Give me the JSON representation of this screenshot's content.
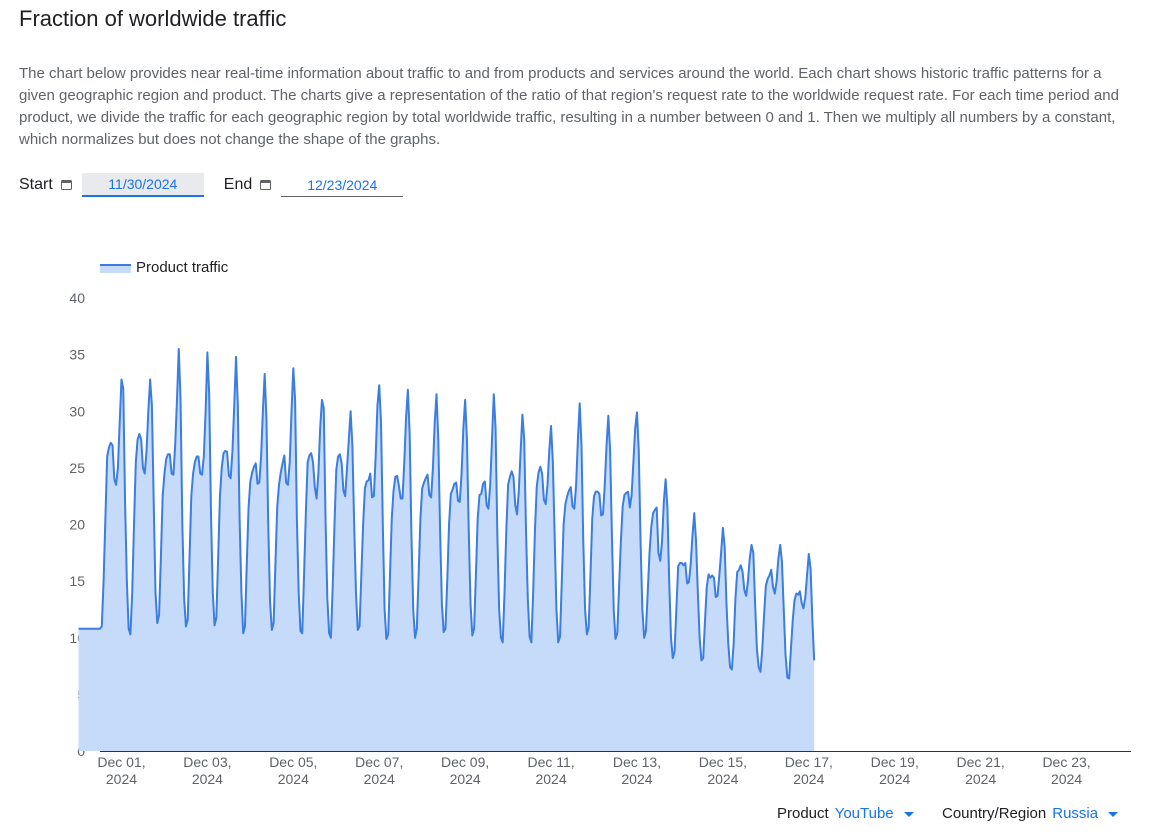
{
  "header": {
    "title": "Fraction of worldwide traffic",
    "description": "The chart below provides near real-time information about traffic to and from products and services around the world. Each chart shows historic traffic patterns for a given geographic region and product. The charts give a representation of the ratio of that region's request rate to the worldwide request rate. For each time period and product, we divide the traffic for each geographic region by total worldwide traffic, resulting in a number between 0 and 1. Then we multiply all numbers by a constant, which normalizes but does not change the shape of the graphs."
  },
  "filters": {
    "start_label": "Start",
    "start_value": "11/30/2024",
    "end_label": "End",
    "end_value": "12/23/2024"
  },
  "footer": {
    "product_label": "Product",
    "product_value": "YouTube",
    "region_label": "Country/Region",
    "region_value": "Russia"
  },
  "colors": {
    "line": "#3b7de0",
    "fill": "#c6dafa",
    "accent": "#1a73e8"
  },
  "chart_data": {
    "type": "area",
    "legend": "top-left",
    "grid": false,
    "series": [
      {
        "name": "Product traffic"
      }
    ],
    "ylim": [
      0,
      40
    ],
    "yticks": [
      0,
      5,
      10,
      15,
      20,
      25,
      30,
      35,
      40
    ],
    "xlim": [
      "2024-11-30T12:00",
      "2024-12-24T12:00"
    ],
    "xticks": [
      {
        "date": "2024-12-01T00:00",
        "line1": "Dec 01,",
        "line2": "2024"
      },
      {
        "date": "2024-12-03T00:00",
        "line1": "Dec 03,",
        "line2": "2024"
      },
      {
        "date": "2024-12-05T00:00",
        "line1": "Dec 05,",
        "line2": "2024"
      },
      {
        "date": "2024-12-07T00:00",
        "line1": "Dec 07,",
        "line2": "2024"
      },
      {
        "date": "2024-12-09T00:00",
        "line1": "Dec 09,",
        "line2": "2024"
      },
      {
        "date": "2024-12-11T00:00",
        "line1": "Dec 11,",
        "line2": "2024"
      },
      {
        "date": "2024-12-13T00:00",
        "line1": "Dec 13,",
        "line2": "2024"
      },
      {
        "date": "2024-12-15T00:00",
        "line1": "Dec 15,",
        "line2": "2024"
      },
      {
        "date": "2024-12-17T00:00",
        "line1": "Dec 17,",
        "line2": "2024"
      },
      {
        "date": "2024-12-19T00:00",
        "line1": "Dec 19,",
        "line2": "2024"
      },
      {
        "date": "2024-12-21T00:00",
        "line1": "Dec 21,",
        "line2": "2024"
      },
      {
        "date": "2024-12-23T00:00",
        "line1": "Dec 23,",
        "line2": "2024"
      }
    ],
    "days": [
      {
        "date": "2024-11-30",
        "values": [
          10.8,
          10.8,
          10.8,
          10.8,
          10.8,
          10.8,
          10.8,
          10.8,
          10.8,
          10.8,
          10.8,
          10.8,
          10.8,
          11,
          15,
          20.5,
          26,
          26.8,
          27.2,
          27,
          24,
          23.5,
          25,
          29
        ]
      },
      {
        "date": "2024-12-01",
        "values": [
          32.8,
          32,
          22,
          15,
          10.8,
          10.3,
          14,
          20,
          25.5,
          27.5,
          28,
          27.5,
          25,
          24.5,
          26.5,
          30,
          32.8,
          30.5,
          22,
          14,
          11.3,
          12,
          17,
          22.5
        ]
      },
      {
        "date": "2024-12-02",
        "values": [
          24.5,
          25.8,
          26.2,
          26.2,
          24.5,
          24.4,
          27,
          31,
          35.5,
          31,
          20,
          13.5,
          11,
          11.6,
          17,
          22.5,
          24.5,
          25.5,
          26,
          26,
          24.5,
          24.4,
          26,
          30
        ]
      },
      {
        "date": "2024-12-03",
        "values": [
          35.2,
          31.5,
          21,
          14,
          11.1,
          11.8,
          17,
          22.5,
          25,
          26.3,
          26.5,
          26.4,
          24.3,
          24.1,
          26.5,
          30.5,
          34.8,
          30.5,
          20.5,
          14,
          10.4,
          11,
          16.5,
          21.5
        ]
      },
      {
        "date": "2024-12-04",
        "values": [
          23.8,
          24.6,
          25.1,
          25.4,
          23.6,
          23.7,
          26,
          30,
          33.3,
          29.3,
          20,
          13.2,
          10.7,
          11.3,
          16.5,
          21.5,
          23.5,
          24.6,
          25.4,
          26.1,
          23.7,
          23.5,
          25.5,
          30
        ]
      },
      {
        "date": "2024-12-05",
        "values": [
          33.8,
          31,
          20.5,
          14,
          10.6,
          10.4,
          15.5,
          21,
          25.5,
          26.1,
          26.3,
          25.5,
          23.3,
          22.3,
          24.5,
          28.5,
          31,
          30.3,
          20.5,
          13.5,
          10.4,
          10,
          14.5,
          20
        ]
      },
      {
        "date": "2024-12-06",
        "values": [
          24.8,
          26,
          26.2,
          25.4,
          23,
          22.5,
          25,
          27.5,
          30,
          27,
          20,
          14,
          10.7,
          11,
          15.5,
          20,
          23.2,
          23.8,
          23.9,
          24.5,
          22.4,
          22.5,
          26,
          30.5
        ]
      },
      {
        "date": "2024-12-07",
        "values": [
          32.3,
          29,
          20,
          12.5,
          9.9,
          10.3,
          15.5,
          20.5,
          23,
          24.2,
          24.3,
          23.4,
          22.3,
          22.3,
          25.5,
          29.5,
          31.9,
          28,
          19,
          12.5,
          10,
          10.8,
          15.5,
          20.5
        ]
      },
      {
        "date": "2024-12-08",
        "values": [
          23.2,
          23.7,
          24.1,
          24.4,
          22.6,
          22.4,
          25,
          29,
          31.5,
          27.5,
          19.5,
          13,
          10.5,
          10.8,
          15,
          20,
          22.7,
          23.1,
          23.6,
          23.7,
          22.1,
          22,
          24.5,
          28.5
        ]
      },
      {
        "date": "2024-12-09",
        "values": [
          31,
          27.5,
          19.5,
          13,
          10.2,
          10.8,
          15.5,
          20.5,
          22.6,
          22.7,
          23.6,
          23.8,
          21.7,
          21.4,
          23.5,
          27.5,
          31.5,
          28.5,
          19,
          12.5,
          10,
          9.6,
          14,
          19.5
        ]
      },
      {
        "date": "2024-12-10",
        "values": [
          23.5,
          24.2,
          24.7,
          24.2,
          21.7,
          20.9,
          23,
          26.5,
          29.7,
          27.5,
          19.5,
          13.5,
          10.1,
          9.6,
          14,
          19.5,
          23.3,
          24.6,
          25.1,
          24.5,
          22.2,
          21.8,
          23.5,
          26.5
        ]
      },
      {
        "date": "2024-12-11",
        "values": [
          28.7,
          25.5,
          19,
          12.5,
          9.6,
          10.1,
          15,
          20,
          21.8,
          22.5,
          23,
          23.3,
          21.6,
          21.4,
          23.5,
          27.5,
          30.7,
          27,
          18.5,
          12.5,
          10.3,
          10.9,
          15.5,
          20.5
        ]
      },
      {
        "date": "2024-12-12",
        "values": [
          22.5,
          22.9,
          22.9,
          22.7,
          20.8,
          20.9,
          23.5,
          27,
          29.6,
          26.5,
          19,
          12.5,
          9.9,
          10.4,
          14.5,
          18.5,
          21.6,
          22.6,
          22.8,
          22.9,
          21.5,
          22.6,
          25.5,
          28.5
        ]
      },
      {
        "date": "2024-12-13",
        "values": [
          29.9,
          26.5,
          18.5,
          12.5,
          10,
          10.6,
          14,
          17.5,
          19.8,
          21,
          21.3,
          21.5,
          17.5,
          16.8,
          18.5,
          22,
          24,
          21.5,
          15,
          10,
          8.2,
          8.8,
          12.5,
          16.3
        ]
      },
      {
        "date": "2024-12-14",
        "values": [
          16.6,
          16.6,
          16.4,
          16.6,
          14.8,
          14.9,
          16.5,
          19,
          21,
          18.5,
          14,
          10,
          8,
          8.2,
          11.5,
          14.5,
          15.6,
          15.3,
          15.5,
          15.3,
          13.6,
          13.7,
          15.5,
          17.5
        ]
      },
      {
        "date": "2024-12-15",
        "values": [
          19.7,
          18,
          13,
          9.5,
          7.4,
          7.2,
          9.5,
          13.5,
          15.8,
          16,
          16.4,
          15.8,
          14.2,
          13.7,
          15,
          17,
          18.2,
          17.5,
          13,
          9,
          7.4,
          7,
          9,
          12
        ]
      },
      {
        "date": "2024-12-16",
        "values": [
          14.6,
          15.2,
          15.5,
          16,
          14.5,
          13.9,
          15,
          17,
          18.2,
          16.7,
          12.5,
          8.5,
          6.5,
          6.4,
          9,
          11.5,
          13.3,
          13.9,
          13.8,
          14.1,
          13.1,
          12.6,
          13.5,
          15.5
        ]
      },
      {
        "date": "2024-12-17",
        "values": [
          17.4,
          16.1,
          11.5,
          8
        ]
      }
    ]
  }
}
